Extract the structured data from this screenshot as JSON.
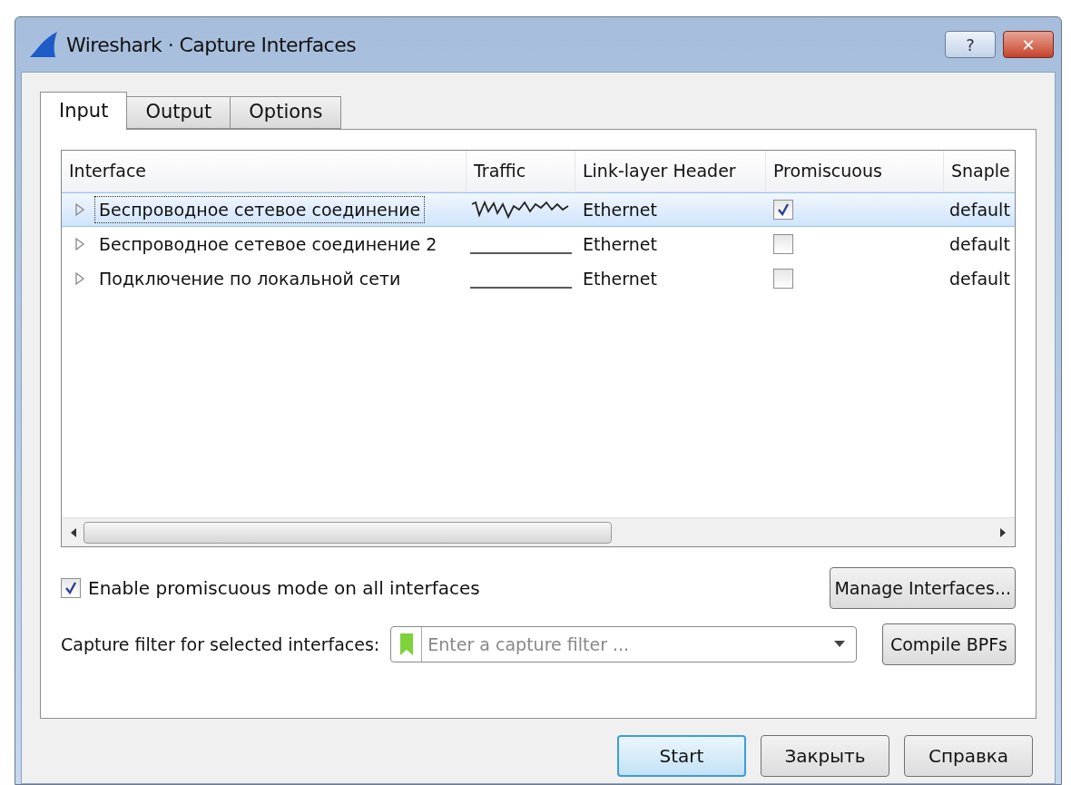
{
  "window": {
    "title": "Wireshark · Capture Interfaces",
    "help_button": "?",
    "close_button": "✕"
  },
  "tabs": [
    {
      "label": "Input",
      "selected": true
    },
    {
      "label": "Output",
      "selected": false
    },
    {
      "label": "Options",
      "selected": false
    }
  ],
  "table": {
    "columns": [
      "Interface",
      "Traffic",
      "Link-layer Header",
      "Promiscuous",
      "Snaple"
    ],
    "rows": [
      {
        "interface": "Беспроводное сетевое соединение",
        "traffic_active": true,
        "link_layer": "Ethernet",
        "promiscuous": true,
        "snaplen": "default",
        "selected": true,
        "expanded": false
      },
      {
        "interface": "Беспроводное сетевое соединение 2",
        "traffic_active": false,
        "link_layer": "Ethernet",
        "promiscuous": false,
        "snaplen": "default",
        "selected": false,
        "expanded": false
      },
      {
        "interface": "Подключение по локальной сети",
        "traffic_active": false,
        "link_layer": "Ethernet",
        "promiscuous": false,
        "snaplen": "default",
        "selected": false,
        "expanded": false
      }
    ]
  },
  "promiscuous_all": {
    "label": "Enable promiscuous mode on all interfaces",
    "checked": true
  },
  "manage_button": "Manage Interfaces...",
  "filter": {
    "label": "Capture filter for selected interfaces:",
    "placeholder": "Enter a capture filter ..."
  },
  "compile_button": "Compile BPFs",
  "buttons": [
    "Start",
    "Закрыть",
    "Справка"
  ]
}
